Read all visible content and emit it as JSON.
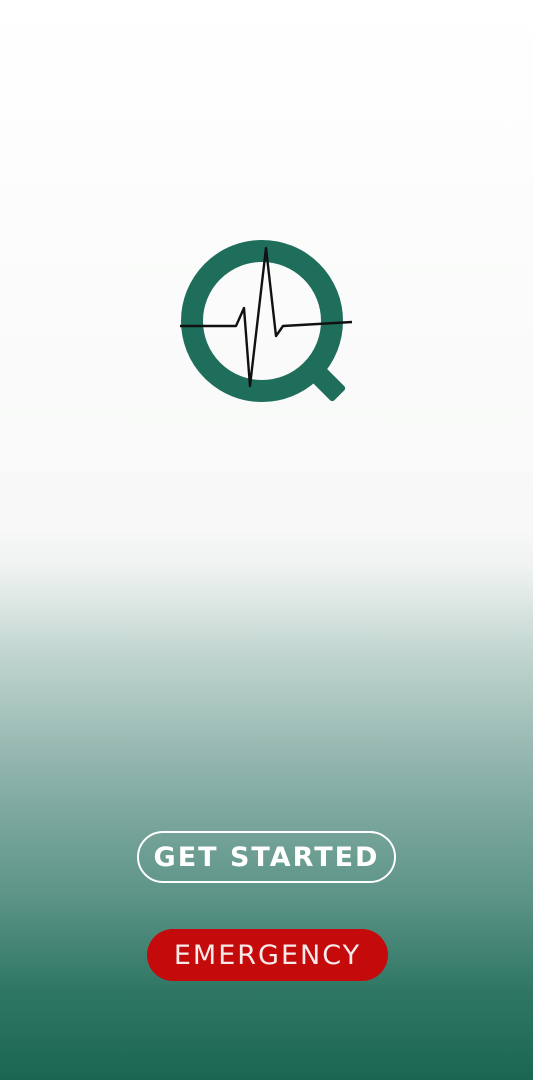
{
  "app": {
    "logo_icon": "magnifier-heartbeat-icon",
    "brand_color": "#1f6e5c"
  },
  "actions": {
    "get_started_label": "GET STARTED",
    "emergency_label": "EMERGENCY",
    "emergency_color": "#c40a0a"
  }
}
